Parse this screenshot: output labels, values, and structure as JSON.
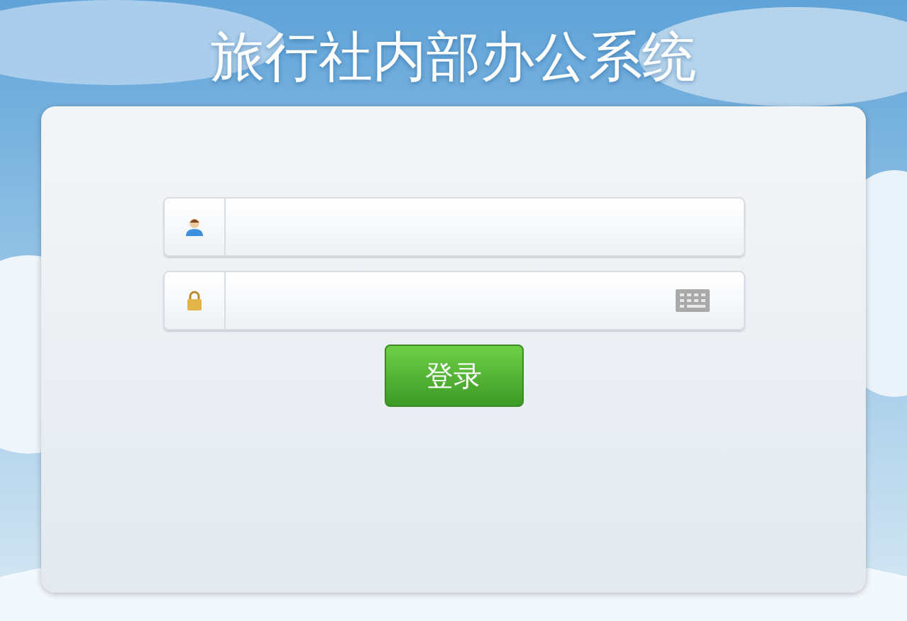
{
  "title": "旅行社内部办公系统",
  "fields": [
    {
      "kind": "user"
    },
    {
      "kind": "password"
    }
  ],
  "login_button": "登录"
}
